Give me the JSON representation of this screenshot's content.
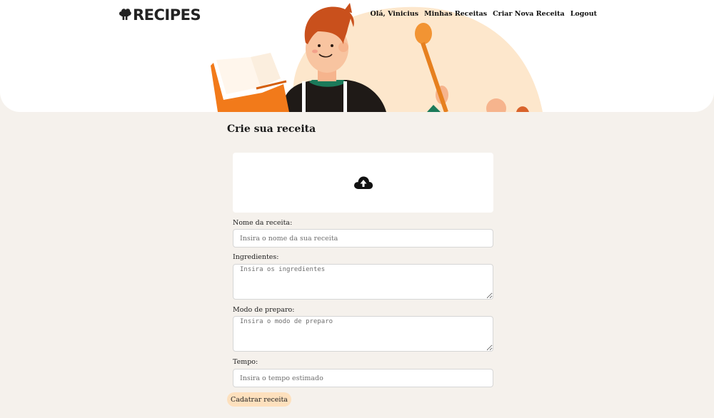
{
  "header": {
    "logo_text": "RECIPES",
    "nav": {
      "greeting": "Olá, Vinicius",
      "my_recipes": "Minhas Receitas",
      "create_recipe": "Criar Nova Receita",
      "logout": "Logout"
    }
  },
  "main": {
    "title": "Crie sua receita",
    "form": {
      "name_label": "Nome da receita:",
      "name_placeholder": "Insira o nome da sua receita",
      "ingredients_label": "Ingredientes:",
      "ingredients_placeholder": "Insira os ingredientes",
      "preparation_label": "Modo de preparo:",
      "preparation_placeholder": "Insira o modo de preparo",
      "time_label": "Tempo:",
      "time_placeholder": "Insira o tempo estimado",
      "submit_label": "Cadatrar receita"
    }
  },
  "colors": {
    "page_background": "#f5f1ec",
    "header_background": "#ffffff",
    "accent_peach": "#fde0bd",
    "accent_orange": "#f07b1e"
  },
  "icons": {
    "logo": "chef-hat-icon",
    "upload": "cloud-upload-icon"
  }
}
